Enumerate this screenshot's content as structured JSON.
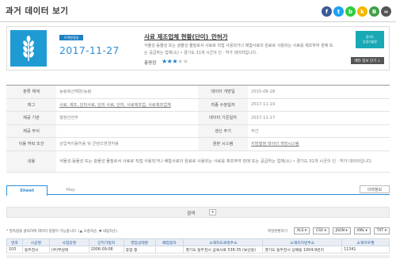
{
  "page": {
    "title": "과거 데이터 보기"
  },
  "share": [
    {
      "icon": "facebook-icon",
      "glyph": "f",
      "color": "#3b5998"
    },
    {
      "icon": "twitter-icon",
      "glyph": "t",
      "color": "#1da1f2"
    },
    {
      "icon": "band-icon",
      "glyph": "b",
      "color": "#2ecc40"
    },
    {
      "icon": "kakaostory-icon",
      "glyph": "k",
      "color": "#f2b600"
    },
    {
      "icon": "blog-icon",
      "glyph": "B",
      "color": "#43a047"
    },
    {
      "icon": "link-icon",
      "glyph": "∞",
      "color": "#555555"
    }
  ],
  "summary": {
    "badge": "이력변경일",
    "date": "2017-11-27",
    "title": "사료 제조업체 현황(단미)_안허가",
    "description": "식물성·동물성 또는 광물성 물질로서 사료로 직접 사용되거나 배합사료의 원료로 사용되는 사료를 제조하여 판매 또는 공급하는 업체(소) • 경기도 31개 시군의 인 · 허가 데이터입니다.",
    "rating_label": "총평점",
    "stars_on": "★★★",
    "stars_off": "★★",
    "logo_text_1": "경기도",
    "logo_text_2": "농업기술원",
    "share_button": "메타 정보 단기 ↓"
  },
  "meta": {
    "rows": [
      {
        "l1": "분류 체계",
        "v1": "농림축산해양)농림",
        "l2": "데이터 개방일",
        "v2": "2015-08-28"
      },
      {
        "l1": "태그",
        "v1": "사료, 제조, 단미사료, 단미 사료, 단미, 사료제조업, 사료제조업체",
        "l2": "최종 수정일자",
        "v2": "2017-11-19"
      },
      {
        "l1": "제공 기관",
        "v1": "행정안전부",
        "l2": "데이터 기준일자",
        "v2": "2017-11-17"
      },
      {
        "l1": "제공 부서",
        "v1": "",
        "l2": "갱신 주기",
        "v2": "주간"
      },
      {
        "l1": "이용 허락 조건",
        "v1": "상업적이용허용 및 콘텐츠변경허용",
        "l2": "원본 시스템",
        "v2": "지방행정 데이터 개방시스템"
      }
    ],
    "content_label": "내용",
    "content": "식물성·동물성 또는 광물성 물질로서 사료로 직접 사용되거나 배합사료의 원료로 사용되는 사료를 제조하여 판매 또는 공급하는 업체(소) • 경기도 31개 시군의 인 · 허가 데이터입니다."
  },
  "tabs": {
    "sheet": "Sheet",
    "map": "Map",
    "guide": "이력정보"
  },
  "search": {
    "label": "검색",
    "toggle": "+"
  },
  "hint": "* 필독항을 클릭하여 데이터 정렬이 가능합니다. (▲ 오름차순, ▼ 내림차순)",
  "download": {
    "label": "파일변환하기",
    "formats": [
      "XLS ▾",
      "CSV ▾",
      "JSON ▾",
      "XML ▾",
      "TXT ▾"
    ]
  },
  "grid": {
    "headers": [
      "번호",
      "시군명",
      "사업장명",
      "인허가일자",
      "영업상태명",
      "폐업일자",
      "소재지도로명주소",
      "소재지지번주소",
      "소재지우편"
    ],
    "rows": [
      [
        "103",
        "동두천시",
        "(주)부원택",
        "2006-09-08",
        "휴업 중",
        "",
        "경기도 동두천시 삼육사로 536-35 (보산동)",
        "경기도 동두천시 상패동 1004-9번지",
        "11341"
      ]
    ]
  }
}
